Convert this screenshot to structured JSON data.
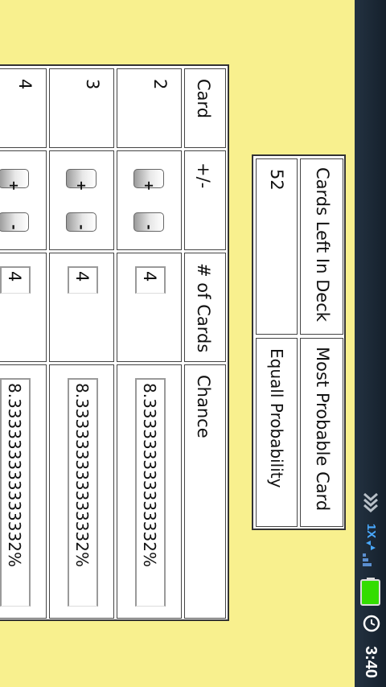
{
  "status_bar": {
    "time": "3:40",
    "data_indicator": "1X",
    "icons": [
      "alarm-icon",
      "battery-icon",
      "signal-icon",
      "data-activity-icon",
      "notification-icon"
    ]
  },
  "deck_info": {
    "headers": {
      "cards_left": "Cards Left In Deck",
      "most_probable": "Most Probable Card"
    },
    "values": {
      "cards_left": "52",
      "most_probable": "Equall Probability"
    }
  },
  "card_table": {
    "headers": {
      "card": "Card",
      "plus_minus": "+/-",
      "num_cards": "# of Cards",
      "chance": "Chance"
    },
    "plus_label": "+",
    "minus_label": "-",
    "rows": [
      {
        "card": "2",
        "count": "4",
        "chance": "8.333333333333332%"
      },
      {
        "card": "3",
        "count": "4",
        "chance": "8.333333333333332%"
      },
      {
        "card": "4",
        "count": "4",
        "chance": "8.333333333333332%"
      }
    ]
  },
  "colors": {
    "background": "#f8f08e",
    "status_bar": "#1c2836",
    "clock": "#ffffff",
    "data_indicator": "#49a9ff",
    "battery": "#33dd00"
  }
}
